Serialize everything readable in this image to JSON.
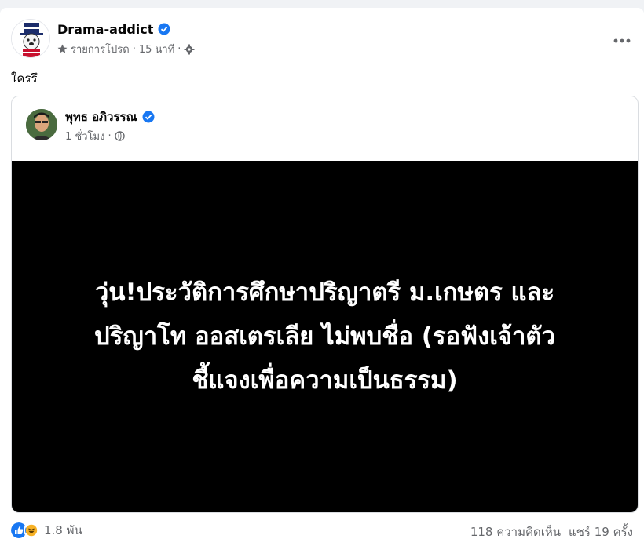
{
  "post": {
    "author": "Drama-addict",
    "meta_label": "รายการโปรด",
    "separator": "·",
    "time": "15 นาที",
    "text": "ใครรึ"
  },
  "shared": {
    "author": "พุทธ อภิวรรณ",
    "time": "1 ชั่วโมง",
    "separator": "·",
    "headline_lines": [
      "วุ่น!ประวัติการศึกษาปริญาตรี ม.เกษตร และ",
      "ปริญาโท ออสเตรเลีย ไม่พบชื่อ (รอฟังเจ้าตัว",
      "ชี้แจงเพื่อความเป็นธรรม)"
    ]
  },
  "footer": {
    "reaction_count": "1.8 พัน",
    "comments": "118 ความคิดเห็น",
    "shares": "แชร์ 19 ครั้ง"
  },
  "icons": {
    "verified": "verified-badge-icon",
    "favorite": "star-icon",
    "privacy": "settings-gear-icon",
    "public": "globe-icon",
    "more": "more-dots-icon",
    "like": "like-reaction-icon",
    "haha": "haha-reaction-icon"
  },
  "colors": {
    "verified_blue": "#1877f2",
    "meta_gray": "#65676b",
    "panel_bg": "#000000",
    "panel_text": "#ffffff"
  }
}
